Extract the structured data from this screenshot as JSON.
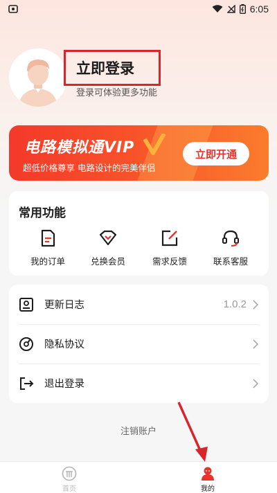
{
  "status_bar": {
    "time": "6:05"
  },
  "profile": {
    "login_title": "立即登录",
    "login_subtitle": "登录可体验更多功能"
  },
  "vip_banner": {
    "title": "电路模拟通VIP",
    "subtitle": "超低价格尊享  电路设计的完美伴侣",
    "button": "立即开通"
  },
  "common_functions": {
    "title": "常用功能",
    "items": [
      {
        "label": "我的订单",
        "icon": "order-icon"
      },
      {
        "label": "兑换会员",
        "icon": "redeem-icon"
      },
      {
        "label": "需求反馈",
        "icon": "feedback-icon"
      },
      {
        "label": "联系客服",
        "icon": "headset-icon"
      }
    ]
  },
  "settings": {
    "rows": [
      {
        "label": "更新日志",
        "value": "1.0.2",
        "icon": "changelog-icon"
      },
      {
        "label": "隐私协议",
        "value": "",
        "icon": "privacy-icon"
      },
      {
        "label": "退出登录",
        "value": "",
        "icon": "logout-icon"
      }
    ]
  },
  "cancel_account": "注销账户",
  "bottom_nav": {
    "items": [
      {
        "label": "首页",
        "active": false
      },
      {
        "label": "我的",
        "active": true
      }
    ]
  },
  "colors": {
    "accent": "#e8322c",
    "annotation": "#d6262b",
    "inactive": "#bbbbbb"
  }
}
